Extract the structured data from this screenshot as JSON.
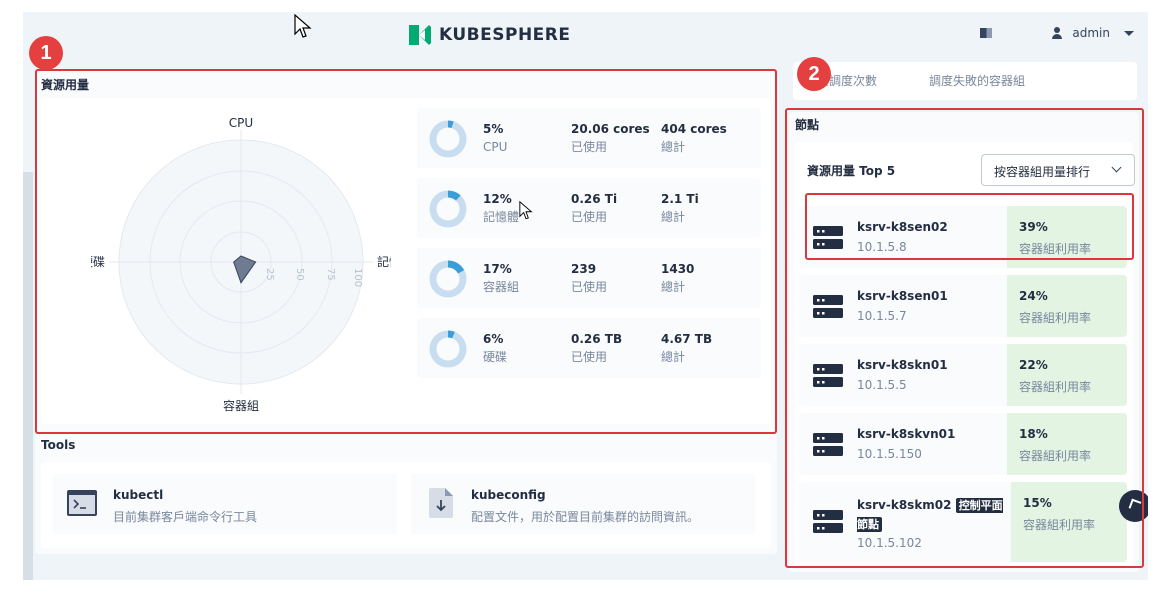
{
  "brand": {
    "name": "KUBESPHERE",
    "accent": "#00aa72"
  },
  "header": {
    "user": "admin"
  },
  "markers": [
    "1",
    "2"
  ],
  "resources": {
    "title": "資源用量",
    "radar": {
      "labels": {
        "top": "CPU",
        "right": "記憶體",
        "bottom": "容器組",
        "left": "硬碟"
      },
      "ticks": [
        "25",
        "50",
        "75",
        "100"
      ]
    },
    "stats": [
      {
        "pct": "5%",
        "name": "CPU",
        "used": "20.06 cores",
        "used_label": "已使用",
        "total": "404 cores",
        "total_label": "總計",
        "fraction": 0.05
      },
      {
        "pct": "12%",
        "name": "記憶體",
        "used": "0.26 Ti",
        "used_label": "已使用",
        "total": "2.1 Ti",
        "total_label": "總計",
        "fraction": 0.12
      },
      {
        "pct": "17%",
        "name": "容器組",
        "used": "239",
        "used_label": "已使用",
        "total": "1430",
        "total_label": "總計",
        "fraction": 0.17
      },
      {
        "pct": "6%",
        "name": "硬碟",
        "used": "0.26 TB",
        "used_label": "已使用",
        "total": "4.67 TB",
        "total_label": "總計",
        "fraction": 0.06
      }
    ]
  },
  "tools": {
    "title": "Tools",
    "items": [
      {
        "name": "kubectl",
        "desc": "目前集群客戶端命令行工具",
        "icon": "terminal-icon"
      },
      {
        "name": "kubeconfig",
        "desc": "配置文件，用於配置目前集群的訪問資訊。",
        "icon": "file-download-icon"
      }
    ]
  },
  "schedule": {
    "a": "器調度次數",
    "b": "調度失敗的容器組"
  },
  "nodes": {
    "title": "節點",
    "top_label": "資源用量 Top 5",
    "sort": "按容器組用量排行",
    "items": [
      {
        "name": "ksrv-k8sen02",
        "ip": "10.1.5.8",
        "pct": "39%",
        "label": "容器組利用率"
      },
      {
        "name": "ksrv-k8sen01",
        "ip": "10.1.5.7",
        "pct": "24%",
        "label": "容器組利用率"
      },
      {
        "name": "ksrv-k8skn01",
        "ip": "10.1.5.5",
        "pct": "22%",
        "label": "容器組利用率"
      },
      {
        "name": "ksrv-k8skvn01",
        "ip": "10.1.5.150",
        "pct": "18%",
        "label": "容器組利用率"
      },
      {
        "name": "ksrv-k8skm02",
        "badge": "控制平面節點",
        "ip": "10.1.5.102",
        "pct": "15%",
        "label": "容器組利用率"
      }
    ]
  },
  "colors": {
    "highlight": "#d9393c",
    "donut_fill": "#3a9fd8",
    "donut_track": "#c8def0",
    "usage_bg": "#e3f4e3"
  }
}
